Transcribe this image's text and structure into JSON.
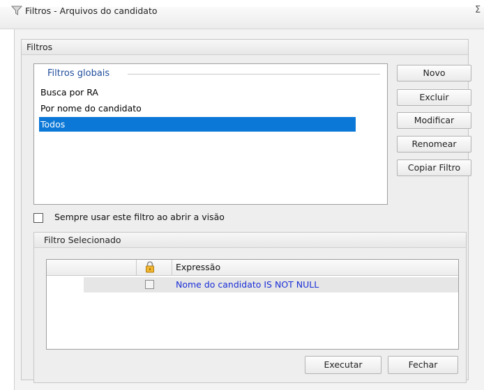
{
  "window": {
    "title": "Filtros - Arquivos do candidato",
    "close_glyph": "Σ"
  },
  "filters_group": {
    "title": "Filtros",
    "list": {
      "section_title": "Filtros globais",
      "items": [
        {
          "label": "Busca por RA",
          "selected": false
        },
        {
          "label": "Por nome do candidato",
          "selected": false
        },
        {
          "label": "Todos",
          "selected": true
        }
      ]
    },
    "buttons": {
      "novo": "Novo",
      "excluir": "Excluir",
      "modificar": "Modificar",
      "renomear": "Renomear",
      "copiar": "Copiar Filtro"
    },
    "always_use_checkbox": {
      "label": "Sempre usar este filtro ao abrir a visão",
      "checked": false
    }
  },
  "selected_filter_group": {
    "title": "Filtro Selecionado",
    "grid": {
      "columns": [
        "",
        "lock-icon",
        "Expressão"
      ],
      "rows": [
        {
          "locked": false,
          "expression": "Nome do candidato IS NOT NULL"
        }
      ]
    }
  },
  "footer": {
    "execute_label": "Executar",
    "close_label": "Fechar"
  },
  "colors": {
    "selection": "#0b78d7",
    "section_title": "#1f4e9c",
    "expression_text": "#1a2ed6"
  }
}
